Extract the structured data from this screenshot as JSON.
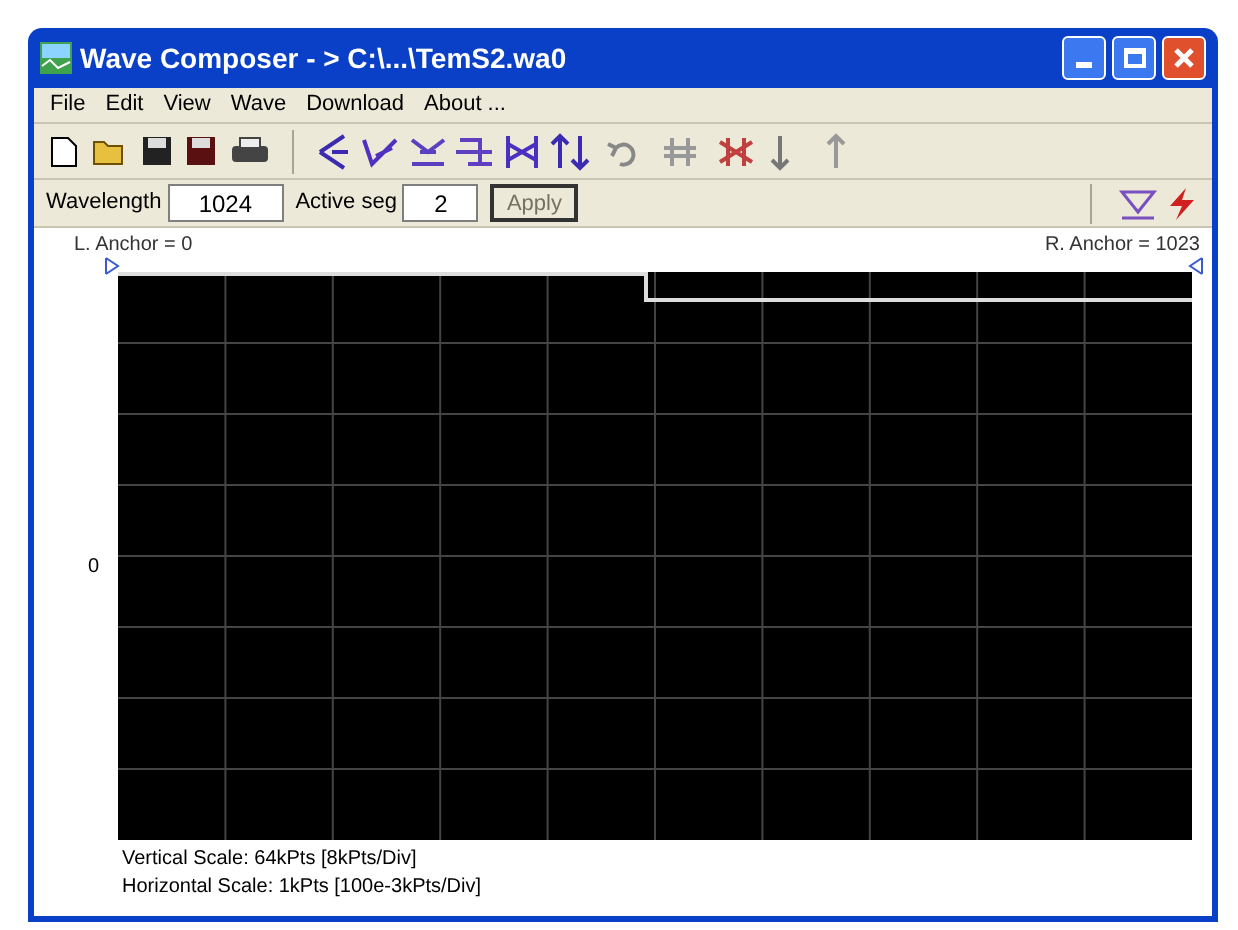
{
  "window": {
    "title": "Wave Composer - > C:\\...\\TemS2.wa0"
  },
  "menu": [
    {
      "label": "File"
    },
    {
      "label": "Edit"
    },
    {
      "label": "View"
    },
    {
      "label": "Wave"
    },
    {
      "label": "Download"
    },
    {
      "label": "About ..."
    }
  ],
  "params": {
    "wavelength_label": "Wavelength",
    "wavelength": "1024",
    "segment_label": "Active seg",
    "segment": "2",
    "apply": {
      "label": "Apply",
      "disabled": true
    }
  },
  "plot": {
    "left_anchor": "L. Anchor = 0",
    "right_anchor": "R. Anchor = 1023",
    "zero_label": "0",
    "vertical_scale": "Vertical Scale: 64kPts  [8kPts/Div]",
    "horizontal_scale": "Horizontal Scale: 1kPts [100e-3kPts/Div]"
  }
}
